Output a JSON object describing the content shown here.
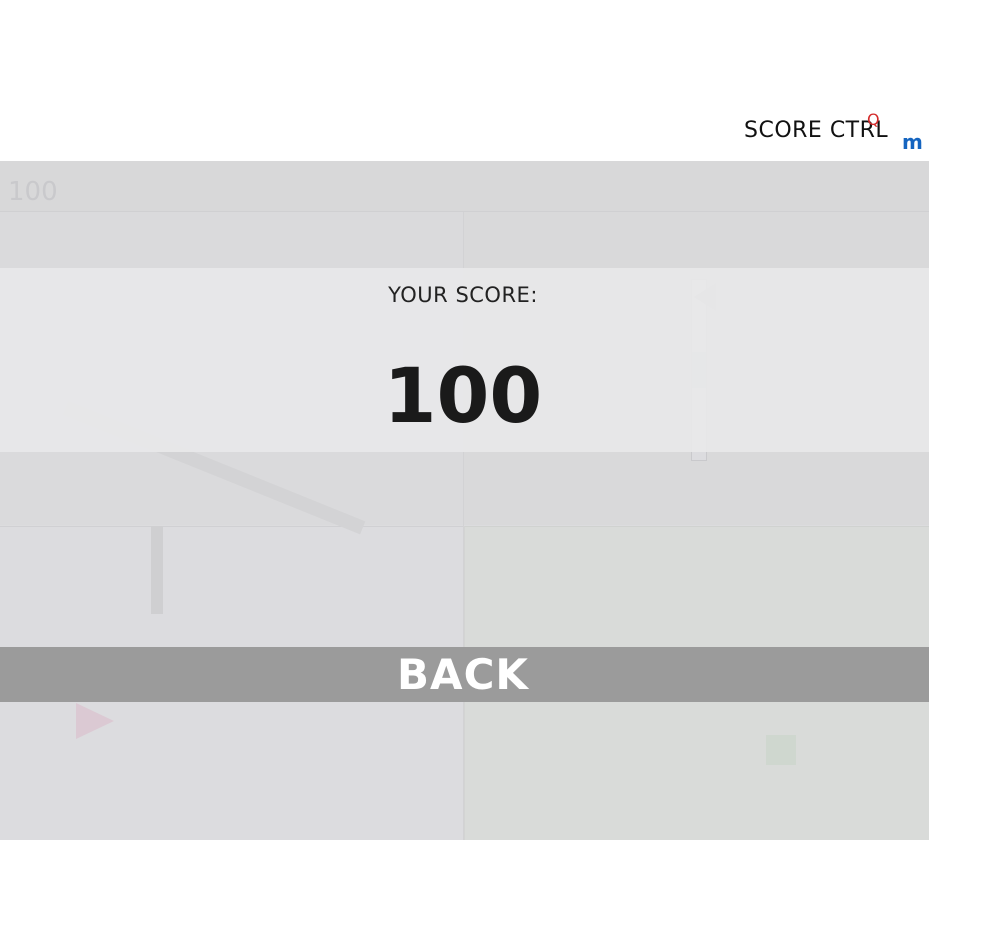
{
  "header": {
    "brand_text": "SCORE CTRL",
    "brand_mark_q": "Q",
    "brand_mark_m": "m"
  },
  "game": {
    "hud_score": "100",
    "colors": {
      "board": "#dcdcde",
      "button": "#9b9b9b",
      "accent_red": "#d42a2a",
      "accent_blue": "#1565c0"
    }
  },
  "result": {
    "label": "YOUR SCORE:",
    "score": "100"
  },
  "actions": {
    "back_label": "BACK"
  }
}
